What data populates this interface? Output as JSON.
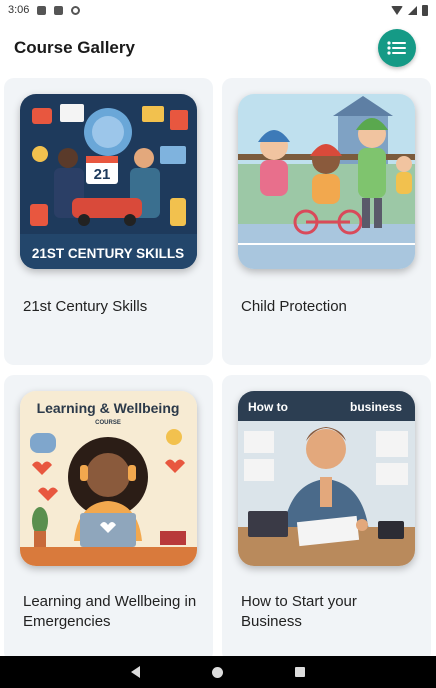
{
  "status_bar": {
    "time": "3:06"
  },
  "app_bar": {
    "title": "Course Gallery",
    "menu_icon": "list-icon",
    "accent_color": "#159a86"
  },
  "courses": [
    {
      "title": "21st Century Skills",
      "banner_text": "21ST CENTURY SKILLS",
      "calendar_number": "21"
    },
    {
      "title": "Child Protection"
    },
    {
      "title": "Learning and Wellbeing in Emergencies",
      "banner_text": "Learning & Wellbeing",
      "banner_subtext": "COURSE"
    },
    {
      "title": "How to Start your Business",
      "banner_text": "How to",
      "banner_text_2": "business"
    }
  ],
  "nav_bar": {
    "buttons": [
      "back",
      "home",
      "recents"
    ]
  }
}
